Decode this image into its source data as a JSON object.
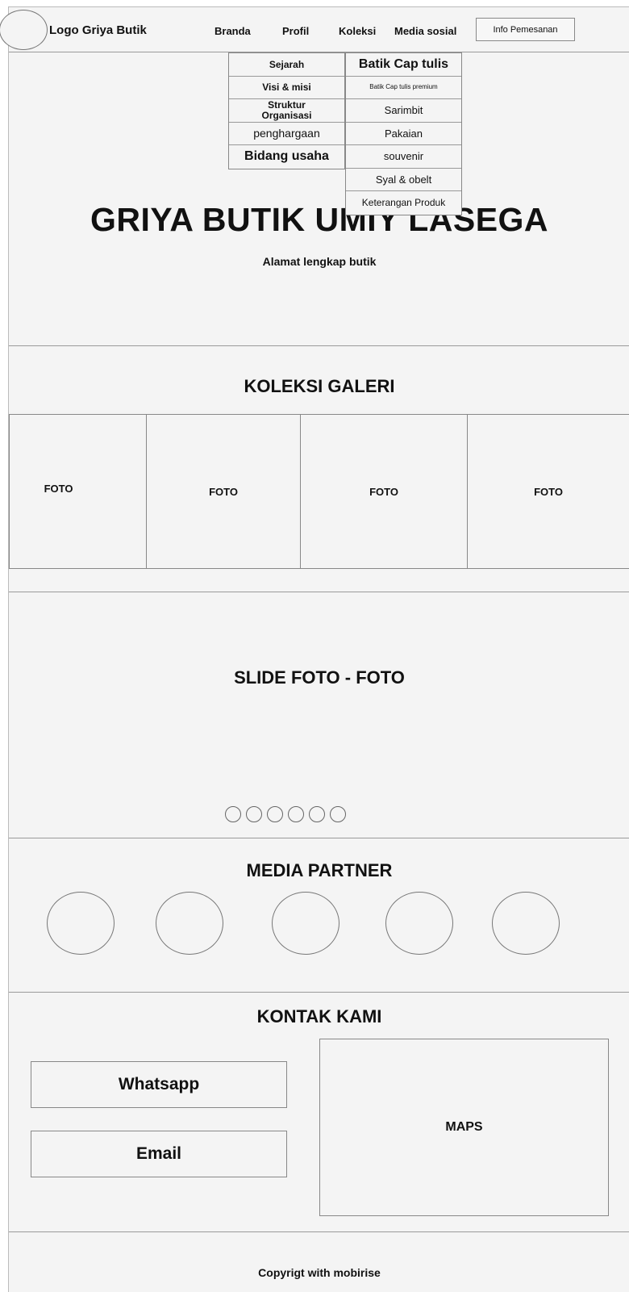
{
  "header": {
    "logo_text": "Logo Griya Butik",
    "nav": [
      "Branda",
      "Profil",
      "Koleksi",
      "Media sosial"
    ],
    "info_button": "Info Pemesanan"
  },
  "profil_menu": [
    "Sejarah",
    "Visi & misi",
    "Struktur Organisasi",
    "penghargaan",
    "Bidang usaha"
  ],
  "koleksi_menu": [
    "Batik Cap tulis",
    "Batik Cap tulis premium",
    "Sarimbit",
    "Pakaian",
    "souvenir",
    "Syal & obelt",
    "Keterangan Produk"
  ],
  "hero": {
    "title": "GRIYA BUTIK UMIY LASEGA",
    "subtitle": "Alamat lengkap butik"
  },
  "gallery": {
    "title": "KOLEKSI GALERI",
    "items": [
      "FOTO",
      "FOTO",
      "FOTO",
      "FOTO"
    ]
  },
  "slider": {
    "title": "SLIDE FOTO - FOTO",
    "dot_count": 6
  },
  "partners": {
    "title": "MEDIA PARTNER",
    "count": 5
  },
  "contact": {
    "title": "KONTAK KAMI",
    "whatsapp": "Whatsapp",
    "email": "Email",
    "maps": "MAPS"
  },
  "footer": {
    "text": "Copyrigt with mobirise"
  }
}
